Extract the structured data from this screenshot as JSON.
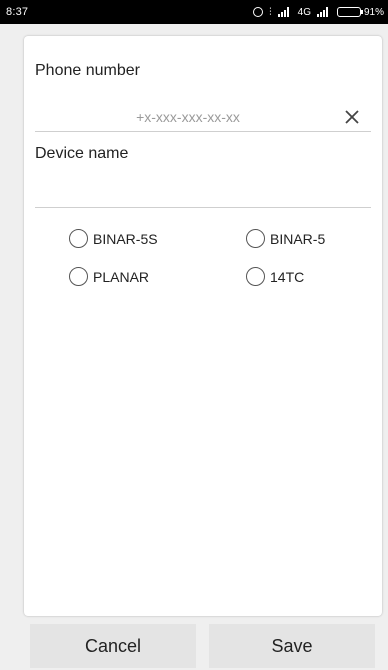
{
  "status_bar": {
    "time": "8:37",
    "network": "4G",
    "battery_text": "91%",
    "battery_level": 0.91,
    "icons": [
      "alarm-icon",
      "vibrate-icon",
      "signal-icon",
      "signal-icon",
      "battery-icon"
    ]
  },
  "form": {
    "phone_label": "Phone number",
    "phone_placeholder": "+x-xxx-xxx-xx-xx",
    "phone_value": "",
    "device_label": "Device name",
    "device_value": "",
    "clear_icon": "close-icon"
  },
  "device_types": [
    {
      "label": "BINAR-5S",
      "selected": false
    },
    {
      "label": "BINAR-5",
      "selected": false
    },
    {
      "label": "PLANAR",
      "selected": false
    },
    {
      "label": "14TC",
      "selected": false
    }
  ],
  "buttons": {
    "cancel": "Cancel",
    "save": "Save"
  },
  "colors": {
    "status_bar_bg": "#000000",
    "card_bg": "#ffffff",
    "page_bg": "#efefef",
    "button_bg": "#e4e4e4"
  }
}
